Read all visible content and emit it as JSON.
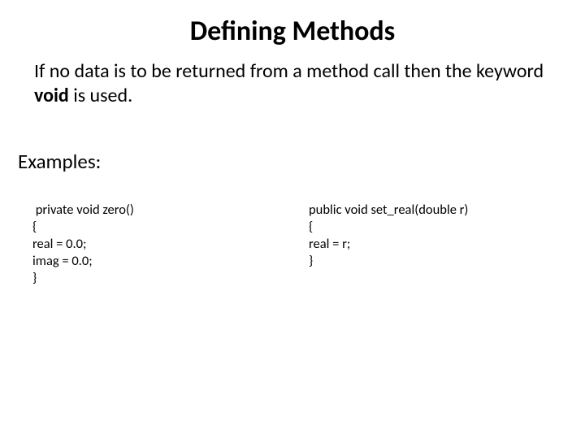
{
  "title": "Defining Methods",
  "description_pre": "If no data is to be returned from a method call then the keyword ",
  "description_bold": "void",
  "description_post": " is used.",
  "examples_label": "Examples:",
  "code_left": " private void zero()\n{\nreal = 0.0;\nimag = 0.0;\n}",
  "code_right": "public void set_real(double r)\n{\nreal = r;\n}"
}
